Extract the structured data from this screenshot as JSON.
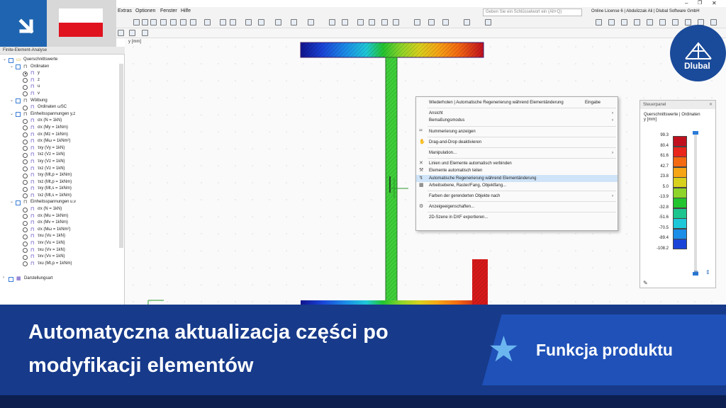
{
  "menubar": {
    "items": [
      "Extras",
      "Optionen",
      "Fenster",
      "Hilfe"
    ],
    "search_placeholder": "Geben Sie ein Schlüsselwort ein (Alt+Q)",
    "license": "Online License 6 | Abdulizzak Ali | Dlubal Software GmbH"
  },
  "left_panel": {
    "title": "Finite-Element-Analyse",
    "tree": [
      {
        "level": 0,
        "label": "Querschnittswerte",
        "kind": "folder",
        "expanded": true
      },
      {
        "level": 1,
        "label": "Ordinaten",
        "kind": "group",
        "expanded": true
      },
      {
        "level": 2,
        "label": "y",
        "kind": "radio",
        "selected": true
      },
      {
        "level": 2,
        "label": "z",
        "kind": "radio"
      },
      {
        "level": 2,
        "label": "u",
        "kind": "radio"
      },
      {
        "level": 2,
        "label": "v",
        "kind": "radio"
      },
      {
        "level": 1,
        "label": "Wölbung",
        "kind": "group",
        "expanded": true
      },
      {
        "level": 2,
        "label": "Ordinaten ωSC",
        "kind": "radio"
      },
      {
        "level": 1,
        "label": "Einheitsspannungen y,z",
        "kind": "group",
        "expanded": true
      },
      {
        "level": 2,
        "label": "σx (N = 1kN)",
        "kind": "radio"
      },
      {
        "level": 2,
        "label": "σx (My = 1kNm)",
        "kind": "radio"
      },
      {
        "level": 2,
        "label": "σx (Mz = 1kNm)",
        "kind": "radio"
      },
      {
        "level": 2,
        "label": "σx (Mω = 1kNm²)",
        "kind": "radio"
      },
      {
        "level": 2,
        "label": "τxy (Vy = 1kN)",
        "kind": "radio"
      },
      {
        "level": 2,
        "label": "τxz (Vz = 1kN)",
        "kind": "radio"
      },
      {
        "level": 2,
        "label": "τxy (Vz = 1kN)",
        "kind": "radio"
      },
      {
        "level": 2,
        "label": "τxz (Vz = 1kN)",
        "kind": "radio"
      },
      {
        "level": 2,
        "label": "τxy (Mt,p = 1kNm)",
        "kind": "radio"
      },
      {
        "level": 2,
        "label": "τxz (Mt,p = 1kNm)",
        "kind": "radio"
      },
      {
        "level": 2,
        "label": "τxy (Mt,s = 1kNm)",
        "kind": "radio"
      },
      {
        "level": 2,
        "label": "τxz (Mt,s = 1kNm)",
        "kind": "radio"
      },
      {
        "level": 1,
        "label": "Einheitsspannungen u,v",
        "kind": "group",
        "expanded": true
      },
      {
        "level": 2,
        "label": "σx (N = 1kN)",
        "kind": "radio"
      },
      {
        "level": 2,
        "label": "σx (Mu = 1kNm)",
        "kind": "radio"
      },
      {
        "level": 2,
        "label": "σx (Mv = 1kNm)",
        "kind": "radio"
      },
      {
        "level": 2,
        "label": "σx (Mω = 1kNm²)",
        "kind": "radio"
      },
      {
        "level": 2,
        "label": "τxu (Vu = 1kN)",
        "kind": "radio"
      },
      {
        "level": 2,
        "label": "τxv (Vu = 1kN)",
        "kind": "radio"
      },
      {
        "level": 2,
        "label": "τxu (Vv = 1kN)",
        "kind": "radio"
      },
      {
        "level": 2,
        "label": "τxv (Vv = 1kN)",
        "kind": "radio"
      },
      {
        "level": 2,
        "label": "τxu (Mt,p = 1kNm)",
        "kind": "radio"
      }
    ],
    "footer_item": "Darstellungsart"
  },
  "canvas": {
    "axis_label": "y [mm]"
  },
  "context_menu": {
    "items": [
      {
        "label": "Wiederholen | Automatische Regenerierung während Elementänderung",
        "shortcut": "Eingabe",
        "icon": ""
      },
      {
        "sep": true
      },
      {
        "label": "Ansicht",
        "submenu": true,
        "icon": ""
      },
      {
        "label": "Bemaßungsmodus",
        "submenu": true,
        "icon": ""
      },
      {
        "sep": true
      },
      {
        "label": "Nummerierung anzeigen",
        "icon": "numbering-icon"
      },
      {
        "sep": true
      },
      {
        "label": "Drag-and-Drop deaktivieren",
        "icon": "drag-icon"
      },
      {
        "sep": true
      },
      {
        "label": "Manipulation...",
        "submenu": true,
        "icon": ""
      },
      {
        "sep": true
      },
      {
        "label": "Linien und Elemente automatisch verbinden",
        "icon": "connect-icon"
      },
      {
        "label": "Elemente automatisch teilen",
        "icon": "split-icon"
      },
      {
        "label": "Automatische Regenerierung während Elementänderung",
        "icon": "regen-icon",
        "highlight": true
      },
      {
        "label": "Arbeitsebene, Raster/Fang, Objektfang...",
        "icon": "grid-icon"
      },
      {
        "sep": true
      },
      {
        "label": "Farben der gerenderten Objekte nach",
        "submenu": true,
        "icon": ""
      },
      {
        "sep": true
      },
      {
        "label": "Anzeigeeigenschaften...",
        "icon": "display-icon"
      },
      {
        "sep": true
      },
      {
        "label": "2D-Szene in DXF exportieren...",
        "icon": ""
      }
    ]
  },
  "control_panel": {
    "title": "Steuerpanel",
    "subtitle_line1": "Querschnittswerte | Ordinaten",
    "subtitle_line2": "y [mm]",
    "legend": [
      {
        "value": "99.3",
        "color": "#c0101e"
      },
      {
        "value": "80.4",
        "color": "#e8261c"
      },
      {
        "value": "61.6",
        "color": "#f46a12"
      },
      {
        "value": "42.7",
        "color": "#f6a516"
      },
      {
        "value": "23.8",
        "color": "#d8d01e"
      },
      {
        "value": "5.0",
        "color": "#8ed42a"
      },
      {
        "value": "-13.9",
        "color": "#22c430"
      },
      {
        "value": "-32.8",
        "color": "#1cc48e"
      },
      {
        "value": "-51.6",
        "color": "#1ec8d8"
      },
      {
        "value": "-70.5",
        "color": "#1c8ee8"
      },
      {
        "value": "-89.4",
        "color": "#1a44d8"
      },
      {
        "value": "-108.2",
        "color": "#10148e"
      }
    ],
    "legend_last_swatch_color": "#0a0a6a"
  },
  "logo": {
    "text": "Dlubal"
  },
  "banner": {
    "title_line1": "Automatyczna aktualizacja części po",
    "title_line2": "modyfikacji elementów",
    "badge": "Funkcja produktu"
  }
}
